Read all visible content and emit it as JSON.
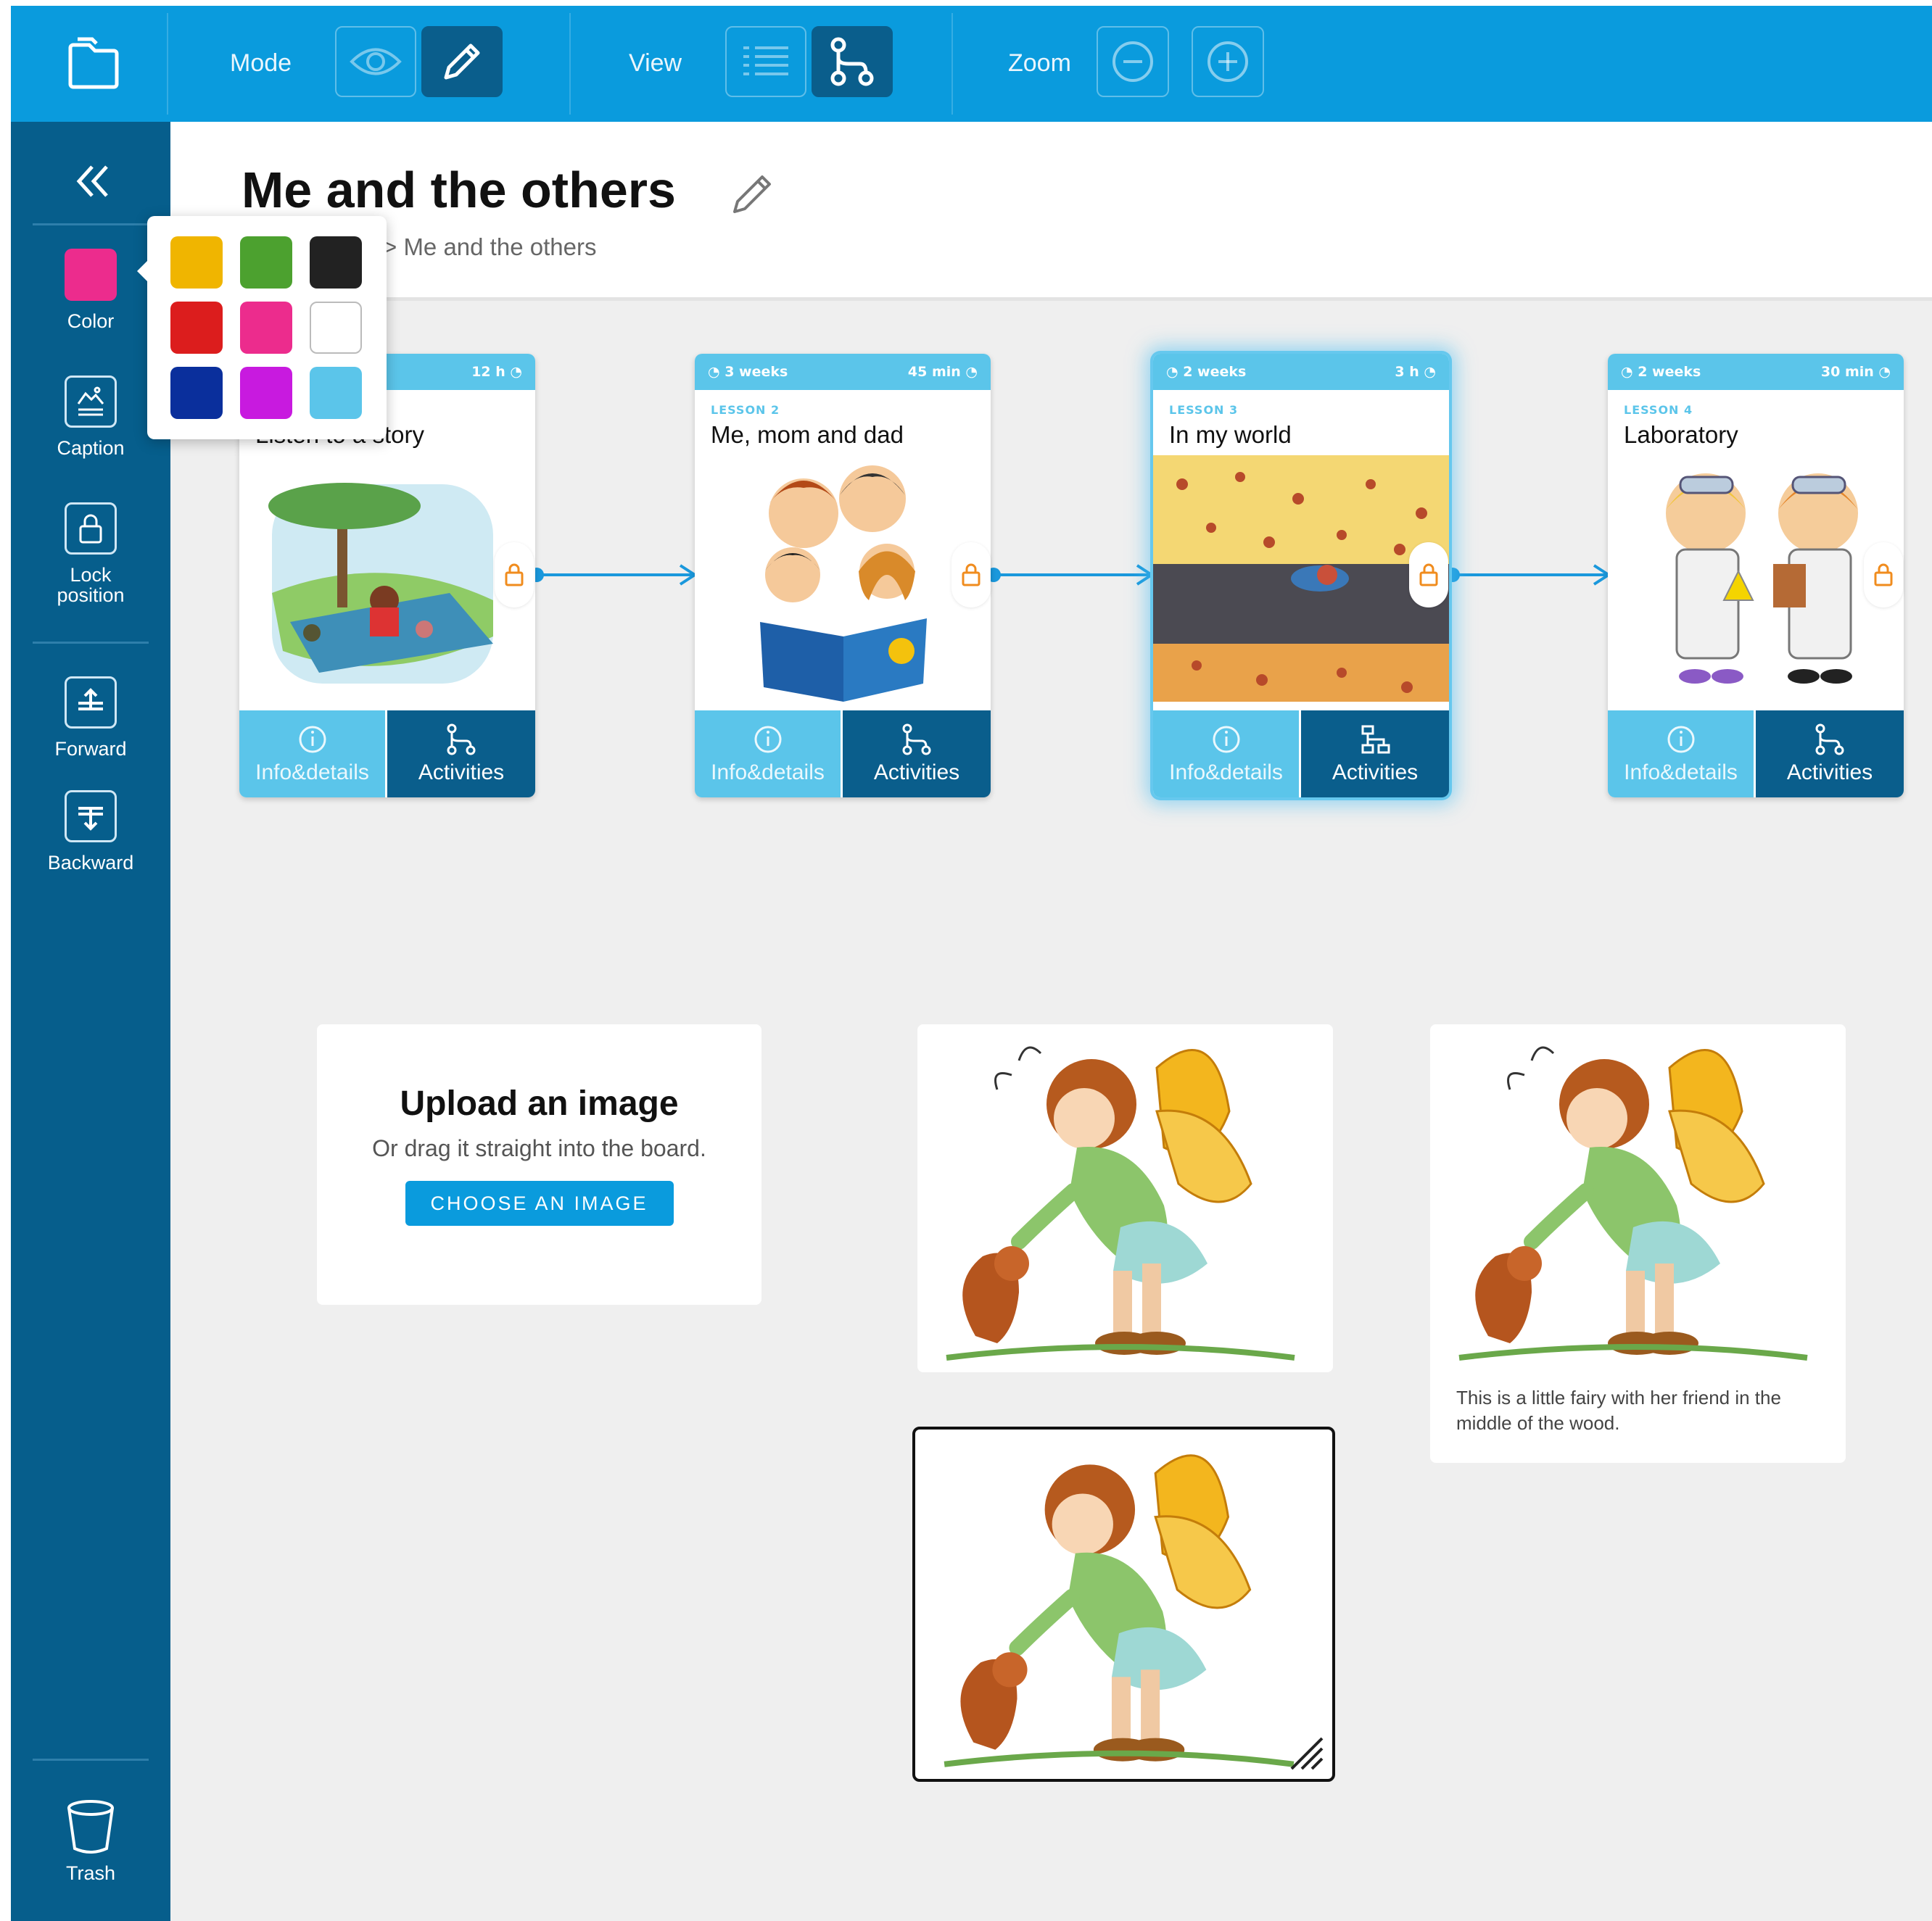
{
  "toolbar": {
    "mode_label": "Mode",
    "view_label": "View",
    "zoom_label": "Zoom",
    "active_mode": "edit",
    "active_view": "path"
  },
  "page": {
    "title": "Me and the others",
    "breadcrumb": "> Me and the others"
  },
  "sidebar": {
    "current_color": "#ec2c8d",
    "color_label": "Color",
    "caption_label": "Caption",
    "lock_label_line1": "Lock",
    "lock_label_line2": "position",
    "forward_label": "Forward",
    "backward_label": "Backward",
    "trash_label": "Trash"
  },
  "palette": [
    "#f0b500",
    "#4ca12f",
    "#222222",
    "#dc1d1d",
    "#ec2c8d",
    "#ffffff",
    "#0a2f9c",
    "#c81adf",
    "#5bc5ea"
  ],
  "lessons": [
    {
      "duration": "",
      "time": "12 h",
      "lesson": "",
      "title": "Listen to a story",
      "info_label": "Info&details",
      "activities_label": "Activities"
    },
    {
      "duration": "3 weeks",
      "time": "45 min",
      "lesson": "LESSON 2",
      "title": "Me, mom and dad",
      "info_label": "Info&details",
      "activities_label": "Activities"
    },
    {
      "duration": "2 weeks",
      "time": "3 h",
      "lesson": "LESSON 3",
      "title": "In my world",
      "info_label": "Info&details",
      "activities_label": "Activities"
    },
    {
      "duration": "2 weeks",
      "time": "30 min",
      "lesson": "LESSON 4",
      "title": "Laboratory",
      "info_label": "Info&details",
      "activities_label": "Activities"
    }
  ],
  "upload": {
    "title": "Upload an image",
    "subtitle": "Or drag it straight into the board.",
    "button": "CHOOSE AN IMAGE"
  },
  "image_caption": "This is a little fairy with her friend in the middle of the wood.",
  "colors": {
    "toolbar": "#0a9bdd",
    "sidebar": "#065e8c",
    "accent": "#5bc5ea",
    "lock": "#f08c1e"
  }
}
